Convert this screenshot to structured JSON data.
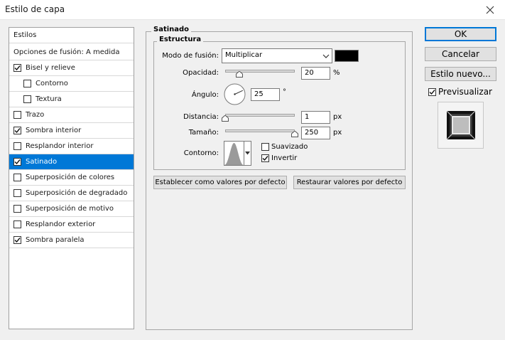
{
  "window": {
    "title": "Estilo de capa"
  },
  "styles_panel": {
    "header": "Estilos",
    "blending_options": "Opciones de fusión: A medida",
    "items": [
      {
        "label": "Bisel y relieve",
        "checked": true,
        "sub": false
      },
      {
        "label": "Contorno",
        "checked": false,
        "sub": true
      },
      {
        "label": "Textura",
        "checked": false,
        "sub": true
      },
      {
        "label": "Trazo",
        "checked": false,
        "sub": false
      },
      {
        "label": "Sombra interior",
        "checked": true,
        "sub": false
      },
      {
        "label": "Resplandor interior",
        "checked": false,
        "sub": false
      },
      {
        "label": "Satinado",
        "checked": true,
        "sub": false,
        "selected": true
      },
      {
        "label": "Superposición de colores",
        "checked": false,
        "sub": false
      },
      {
        "label": "Superposición de degradado",
        "checked": false,
        "sub": false
      },
      {
        "label": "Superposición de motivo",
        "checked": false,
        "sub": false
      },
      {
        "label": "Resplandor exterior",
        "checked": false,
        "sub": false
      },
      {
        "label": "Sombra paralela",
        "checked": true,
        "sub": false
      }
    ]
  },
  "satin": {
    "group_title": "Satinado",
    "structure_title": "Estructura",
    "blend_mode": {
      "label": "Modo de fusión:",
      "value": "Multiplicar",
      "color": "#000000"
    },
    "opacity": {
      "label": "Opacidad:",
      "value": "20",
      "unit": "%",
      "fraction": 0.2
    },
    "angle": {
      "label": "Ángulo:",
      "value": "25",
      "unit": "°",
      "degrees": 25
    },
    "distance": {
      "label": "Distancia:",
      "value": "1",
      "unit": "px",
      "fraction": 0.0
    },
    "size": {
      "label": "Tamaño:",
      "value": "250",
      "unit": "px",
      "fraction": 1.0
    },
    "contour": {
      "label": "Contorno:",
      "antialiased_label": "Suavizado",
      "antialiased": false,
      "invert_label": "Invertir",
      "invert": true
    },
    "set_default": "Establecer como valores por defecto",
    "reset_default": "Restaurar valores por defecto"
  },
  "actions": {
    "ok": "OK",
    "cancel": "Cancelar",
    "new_style": "Estilo nuevo...",
    "preview_label": "Previsualizar",
    "preview_checked": true
  },
  "accent_color": "#0078d7"
}
